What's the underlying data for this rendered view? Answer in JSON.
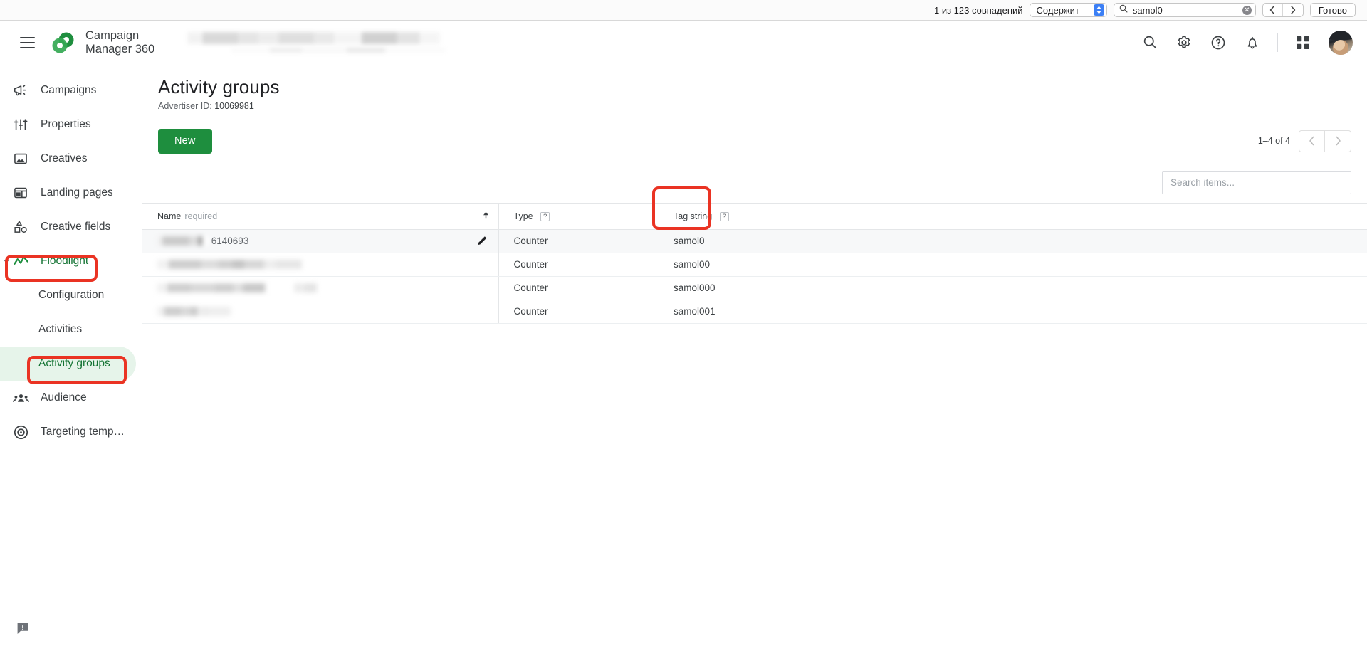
{
  "findbar": {
    "count_text": "1 из 123 совпадений",
    "match_mode": "Содержит",
    "search_value": "samol0",
    "search_icon": "search-icon",
    "clear_icon": "clear-icon",
    "prev_icon": "chevron-left-icon",
    "next_icon": "chevron-right-icon",
    "done_label": "Готово"
  },
  "header": {
    "menu_icon": "hamburger-menu-icon",
    "logo_icon": "campaign-manager-logo-icon",
    "product_line1": "Campaign",
    "product_line2": "Manager 360",
    "icons": {
      "search": "search-icon",
      "settings": "gear-icon",
      "help": "help-icon",
      "notifications": "bell-icon",
      "apps": "apps-grid-icon",
      "avatar": "user-avatar"
    }
  },
  "sidebar": {
    "items": [
      {
        "label": "Campaigns",
        "icon": "megaphone-icon",
        "level": 0,
        "state": "default"
      },
      {
        "label": "Properties",
        "icon": "sliders-icon",
        "level": 0,
        "state": "default"
      },
      {
        "label": "Creatives",
        "icon": "image-icon",
        "level": 0,
        "state": "default"
      },
      {
        "label": "Landing pages",
        "icon": "layout-icon",
        "level": 0,
        "state": "default"
      },
      {
        "label": "Creative fields",
        "icon": "shapes-icon",
        "level": 0,
        "state": "default"
      },
      {
        "label": "Floodlight",
        "icon": "line-chart-icon",
        "level": 0,
        "state": "expanded-green"
      },
      {
        "label": "Configuration",
        "icon": "",
        "level": 1,
        "state": "default"
      },
      {
        "label": "Activities",
        "icon": "",
        "level": 1,
        "state": "default"
      },
      {
        "label": "Activity groups",
        "icon": "",
        "level": 1,
        "state": "active"
      },
      {
        "label": "Audience",
        "icon": "people-icon",
        "level": 0,
        "state": "default"
      },
      {
        "label": "Targeting temp…",
        "icon": "target-icon",
        "level": 0,
        "state": "default"
      }
    ],
    "feedback_icon": "feedback-icon"
  },
  "page": {
    "title": "Activity groups",
    "subtitle_label": "Advertiser ID:",
    "subtitle_value": "10069981"
  },
  "toolbar": {
    "new_label": "New",
    "pager_label": "1–4 of 4",
    "prev_icon": "chevron-left-icon",
    "next_icon": "chevron-right-icon"
  },
  "search": {
    "placeholder": "Search items...",
    "value": ""
  },
  "table": {
    "columns": [
      {
        "label": "Name",
        "suffix": "required",
        "help": false,
        "sortable": true,
        "sort_icon": "sort-ascending-icon"
      },
      {
        "label": "Type",
        "suffix": "",
        "help": true,
        "sortable": false
      },
      {
        "label": "Tag string",
        "suffix": "",
        "help": true,
        "sortable": false
      }
    ],
    "help_glyph": "?",
    "rows": [
      {
        "name_redacted": true,
        "id": "6140693",
        "type": "Counter",
        "tag_string": "samol0",
        "edit_icon": "edit-pencil-icon",
        "selected": true
      },
      {
        "name_redacted": true,
        "id": "",
        "type": "Counter",
        "tag_string": "samol00",
        "edit_icon": "",
        "selected": false
      },
      {
        "name_redacted": true,
        "id": "",
        "type": "Counter",
        "tag_string": "samol000",
        "edit_icon": "",
        "selected": false
      },
      {
        "name_redacted": true,
        "id": "",
        "type": "Counter",
        "tag_string": "samol001",
        "edit_icon": "",
        "selected": false
      }
    ]
  },
  "annotations": {
    "color": "#ea3323",
    "boxes": [
      {
        "name": "floodlight-highlight"
      },
      {
        "name": "activity-groups-highlight"
      },
      {
        "name": "tag-string-column-highlight"
      }
    ]
  },
  "colors": {
    "brand_green": "#1e8e3e",
    "active_green_text": "#137333",
    "active_green_bg": "#e6f4ea",
    "annotation_red": "#ea3323"
  }
}
